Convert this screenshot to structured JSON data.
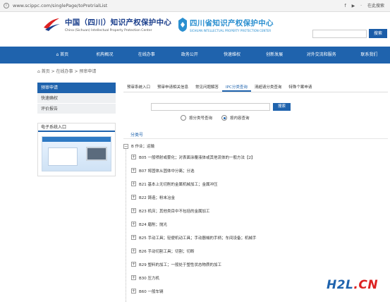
{
  "browser": {
    "url": "www.scippc.com/singlePage/toPretrialList",
    "tools": [
      "f",
      "▶",
      "·",
      "在此搜索"
    ]
  },
  "header": {
    "logo1_title": "中国（四川）知识产权保护中心",
    "logo1_sub": "China (Sichuan) Intellectual Property Protection Center",
    "logo2_title": "四川省知识产权保护中心",
    "logo2_sub": "SICHUAN INTELLECTUAL PROPERTY PROTECTION CENTER",
    "search_button": "搜索"
  },
  "nav": {
    "items": [
      "首页",
      "机构概况",
      "在线办事",
      "政务公开",
      "快速维权",
      "创新发展",
      "对外交流和服务",
      "联系我们"
    ]
  },
  "breadcrumb": "首页 > 在线办事 > 预审申请",
  "sidebar": {
    "active": "预审申请",
    "items": [
      "快速确权",
      "评价报告"
    ],
    "esystem_title": "电子系统入口"
  },
  "tabs": [
    "预审系统入口",
    "预审申请相关信息",
    "常见问题解答",
    "IPC分类查询",
    "清超请分类查询",
    "特殊个案申请"
  ],
  "query": {
    "button": "搜索",
    "radio1": "按分类号查询",
    "radio2": "按内容查询",
    "field_label": "分类号"
  },
  "tree": {
    "root": "B 作业；运输",
    "items": [
      "B05 一般喷射或雾化；对表面涂覆液体或其他流体的一般方法【2】",
      "B07 将固体从固体中分离；分选",
      "B21 基本上无切削的金属机械加工；金属冲压",
      "B22 铸造；粉末冶金",
      "B23 机床；其他类目中不包括的金属加工",
      "B24 磨削；抛光",
      "B25 手动工具；轻便机动工具；手动器械的手柄；车间设备；机械手",
      "B26 手动切割工具；切割；切断",
      "B29 塑料的加工；一般处于塑性状态物质的加工",
      "B30 压力机",
      "B60 一般车辆"
    ]
  },
  "watermark": {
    "main": "H2L",
    "tail": ".CN"
  }
}
